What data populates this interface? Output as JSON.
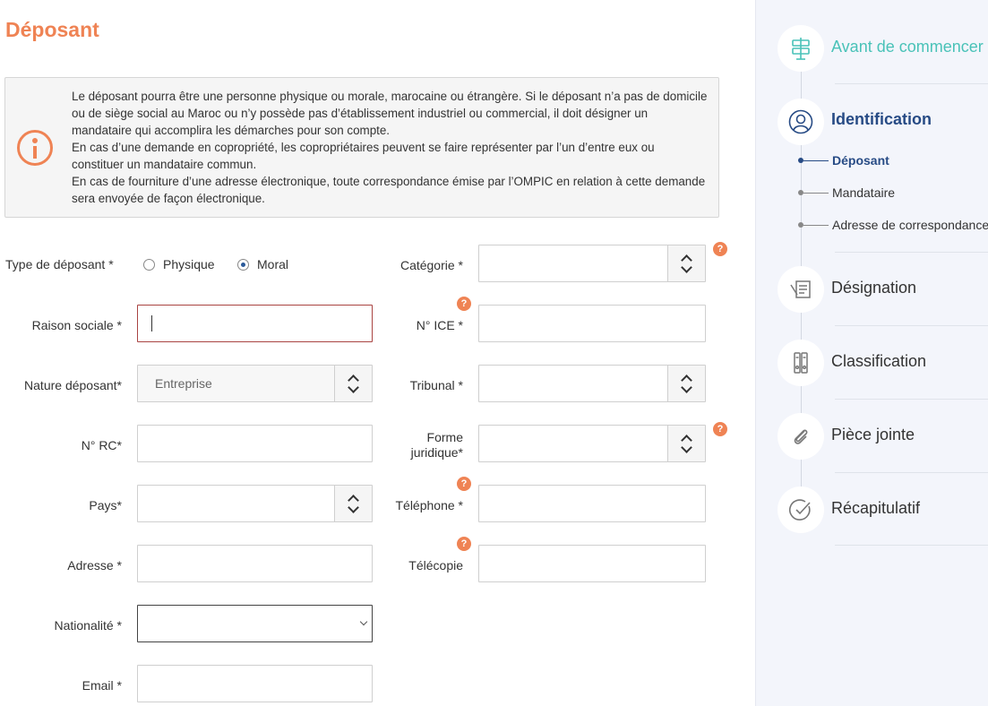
{
  "page": {
    "title": "Déposant",
    "info_paragraphs": [
      "Le déposant pourra être une personne physique ou morale, marocaine ou étrangère. Si le déposant n’a pas de domicile ou de siège social au Maroc ou n’y possède pas d’établissement industriel ou commercial, il doit désigner un mandataire qui accomplira les démarches pour son compte.",
      "En cas d’une demande en copropriété, les copropriétaires peuvent se faire représenter par l’un d’entre eux ou constituer un mandataire commun.",
      "En cas de fourniture d’une adresse électronique, toute correspondance émise par l’OMPIC en relation à cette demande sera envoyée de façon électronique."
    ]
  },
  "form": {
    "type_label": "Type de déposant *",
    "type_options": [
      "Physique",
      "Moral"
    ],
    "type_selected": "Moral",
    "raison_label": "Raison sociale *",
    "raison_value": "",
    "nature_label": "Nature déposant*",
    "nature_value": "Entreprise",
    "rc_label": "N° RC*",
    "pays_label": "Pays*",
    "adresse_label": "Adresse *",
    "nationalite_label": "Nationalité *",
    "email_label": "Email *",
    "categorie_label": "Catégorie *",
    "ice_label": "N° ICE *",
    "tribunal_label": "Tribunal *",
    "forme_label_1": "Forme",
    "forme_label_2": "juridique*",
    "telephone_label": "Téléphone *",
    "telecopie_label": "Télécopie",
    "help_glyph": "?"
  },
  "sidebar": {
    "steps": [
      {
        "label": "Avant de commencer",
        "icon": "signpost-icon",
        "state": "done",
        "color": "#49c2b8"
      },
      {
        "label": "Identification",
        "icon": "user-icon",
        "state": "active",
        "color": "#274b85"
      },
      {
        "label": "Désignation",
        "icon": "document-pen-icon",
        "state": "todo"
      },
      {
        "label": "Classification",
        "icon": "binders-icon",
        "state": "todo"
      },
      {
        "label": "Pièce jointe",
        "icon": "paperclip-icon",
        "state": "todo"
      },
      {
        "label": "Récapitulatif",
        "icon": "check-circle-icon",
        "state": "todo"
      }
    ],
    "substeps": [
      {
        "label": "Déposant",
        "active": true
      },
      {
        "label": "Mandataire",
        "active": false
      },
      {
        "label": "Adresse de correspondance",
        "active": false
      }
    ]
  },
  "colors": {
    "accent": "#ef8354",
    "primary": "#274b85",
    "done": "#49c2b8"
  }
}
